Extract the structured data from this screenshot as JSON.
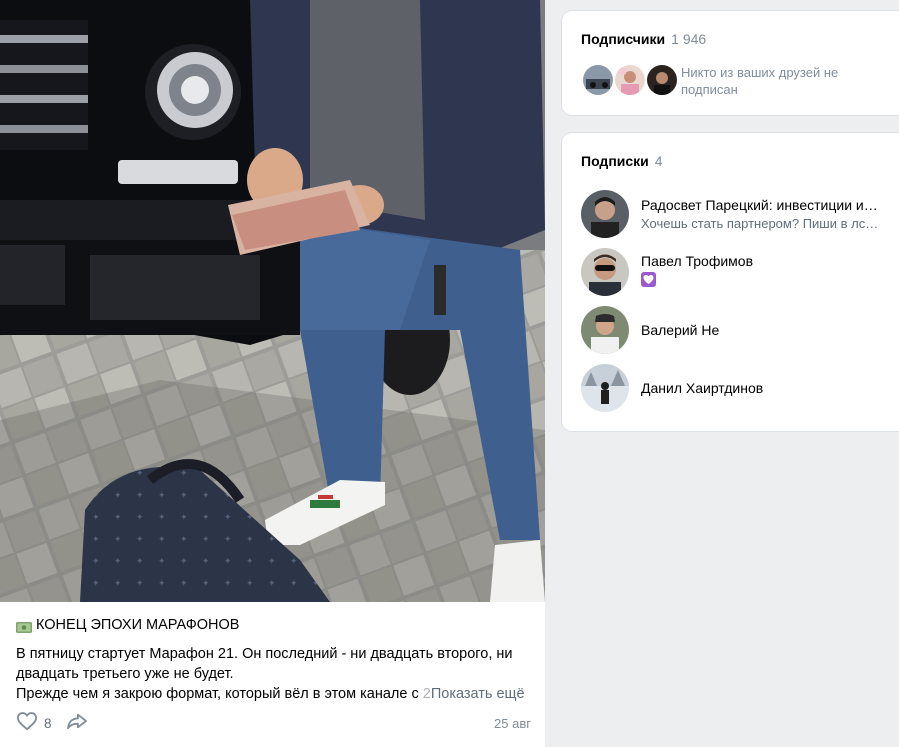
{
  "post": {
    "title": "КОНЕЦ ЭПОХИ МАРАФОНОВ",
    "title_icon": "money-icon",
    "lines": [
      "В пятницу стартует Марафон 21. Он последний - ни двадцать второго, ни",
      "двадцать третьего уже не будет."
    ],
    "line3_main": "Прежде чем я закрою формат, который вёл в этом канале с ",
    "line3_fade": "2",
    "show_more": "Показать ещё",
    "likes": "8",
    "date": "25 авг"
  },
  "subscribers": {
    "title": "Подписчики",
    "count": "1 946",
    "note": "Никто из ваших друзей не подписан"
  },
  "following": {
    "title": "Подписки",
    "count": "4",
    "items": [
      {
        "name": "Радосвет Парецкий: инвестиции и…",
        "desc": "Хочешь стать партнером? Пиши в лс…"
      },
      {
        "name": "Павел Трофимов",
        "desc": ""
      },
      {
        "name": "Валерий Не",
        "desc": ""
      },
      {
        "name": "Данил Хаиртдинов",
        "desc": ""
      }
    ]
  },
  "colors": {
    "page_bg": "#edeef0",
    "secondary_text": "#818c99",
    "badge_purple": "#9b59d0"
  }
}
